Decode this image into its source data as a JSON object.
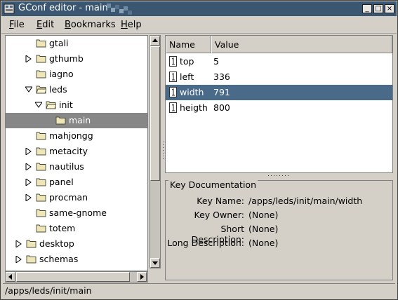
{
  "window": {
    "title": "GConf editor - main"
  },
  "menu": [
    {
      "label": "File",
      "mn": "F",
      "rest": "ile"
    },
    {
      "label": "Edit",
      "mn": "E",
      "rest": "dit"
    },
    {
      "label": "Bookmarks",
      "mn": "B",
      "rest": "ookmarks"
    },
    {
      "label": "Help",
      "mn": "H",
      "rest": "elp"
    }
  ],
  "tree": {
    "rows": [
      {
        "label": "gtali",
        "expander": "none"
      },
      {
        "label": "gthumb",
        "expander": "collapsed"
      },
      {
        "label": "iagno",
        "expander": "none"
      },
      {
        "label": "leds",
        "expander": "expanded"
      },
      {
        "label": "init",
        "expander": "expanded"
      },
      {
        "label": "main",
        "expander": "none",
        "selected": true
      },
      {
        "label": "mahjongg",
        "expander": "none"
      },
      {
        "label": "metacity",
        "expander": "collapsed"
      },
      {
        "label": "nautilus",
        "expander": "collapsed"
      },
      {
        "label": "panel",
        "expander": "collapsed"
      },
      {
        "label": "procman",
        "expander": "collapsed"
      },
      {
        "label": "same-gnome",
        "expander": "none"
      },
      {
        "label": "totem",
        "expander": "none"
      },
      {
        "label": "desktop",
        "expander": "collapsed"
      },
      {
        "label": "schemas",
        "expander": "collapsed"
      }
    ]
  },
  "list": {
    "headers": {
      "name": "Name",
      "value": "Value"
    },
    "rows": [
      {
        "name": "top",
        "value": "5"
      },
      {
        "name": "left",
        "value": "336"
      },
      {
        "name": "width",
        "value": "791",
        "selected": true
      },
      {
        "name": "heigth",
        "value": "800"
      }
    ]
  },
  "doc": {
    "title": "Key Documentation",
    "fields": [
      {
        "label": "Key Name:",
        "value": "/apps/leds/init/main/width"
      },
      {
        "label": "Key Owner:",
        "value": "(None)"
      },
      {
        "label": "Short Description:",
        "value": "(None)"
      },
      {
        "label": "Long Description:",
        "value": "(None)"
      }
    ]
  },
  "status": {
    "path": "/apps/leds/init/main"
  },
  "colors": {
    "titlebar": "#3a5670",
    "selection_list": "#4a6a8a",
    "selection_tree": "#878787"
  }
}
